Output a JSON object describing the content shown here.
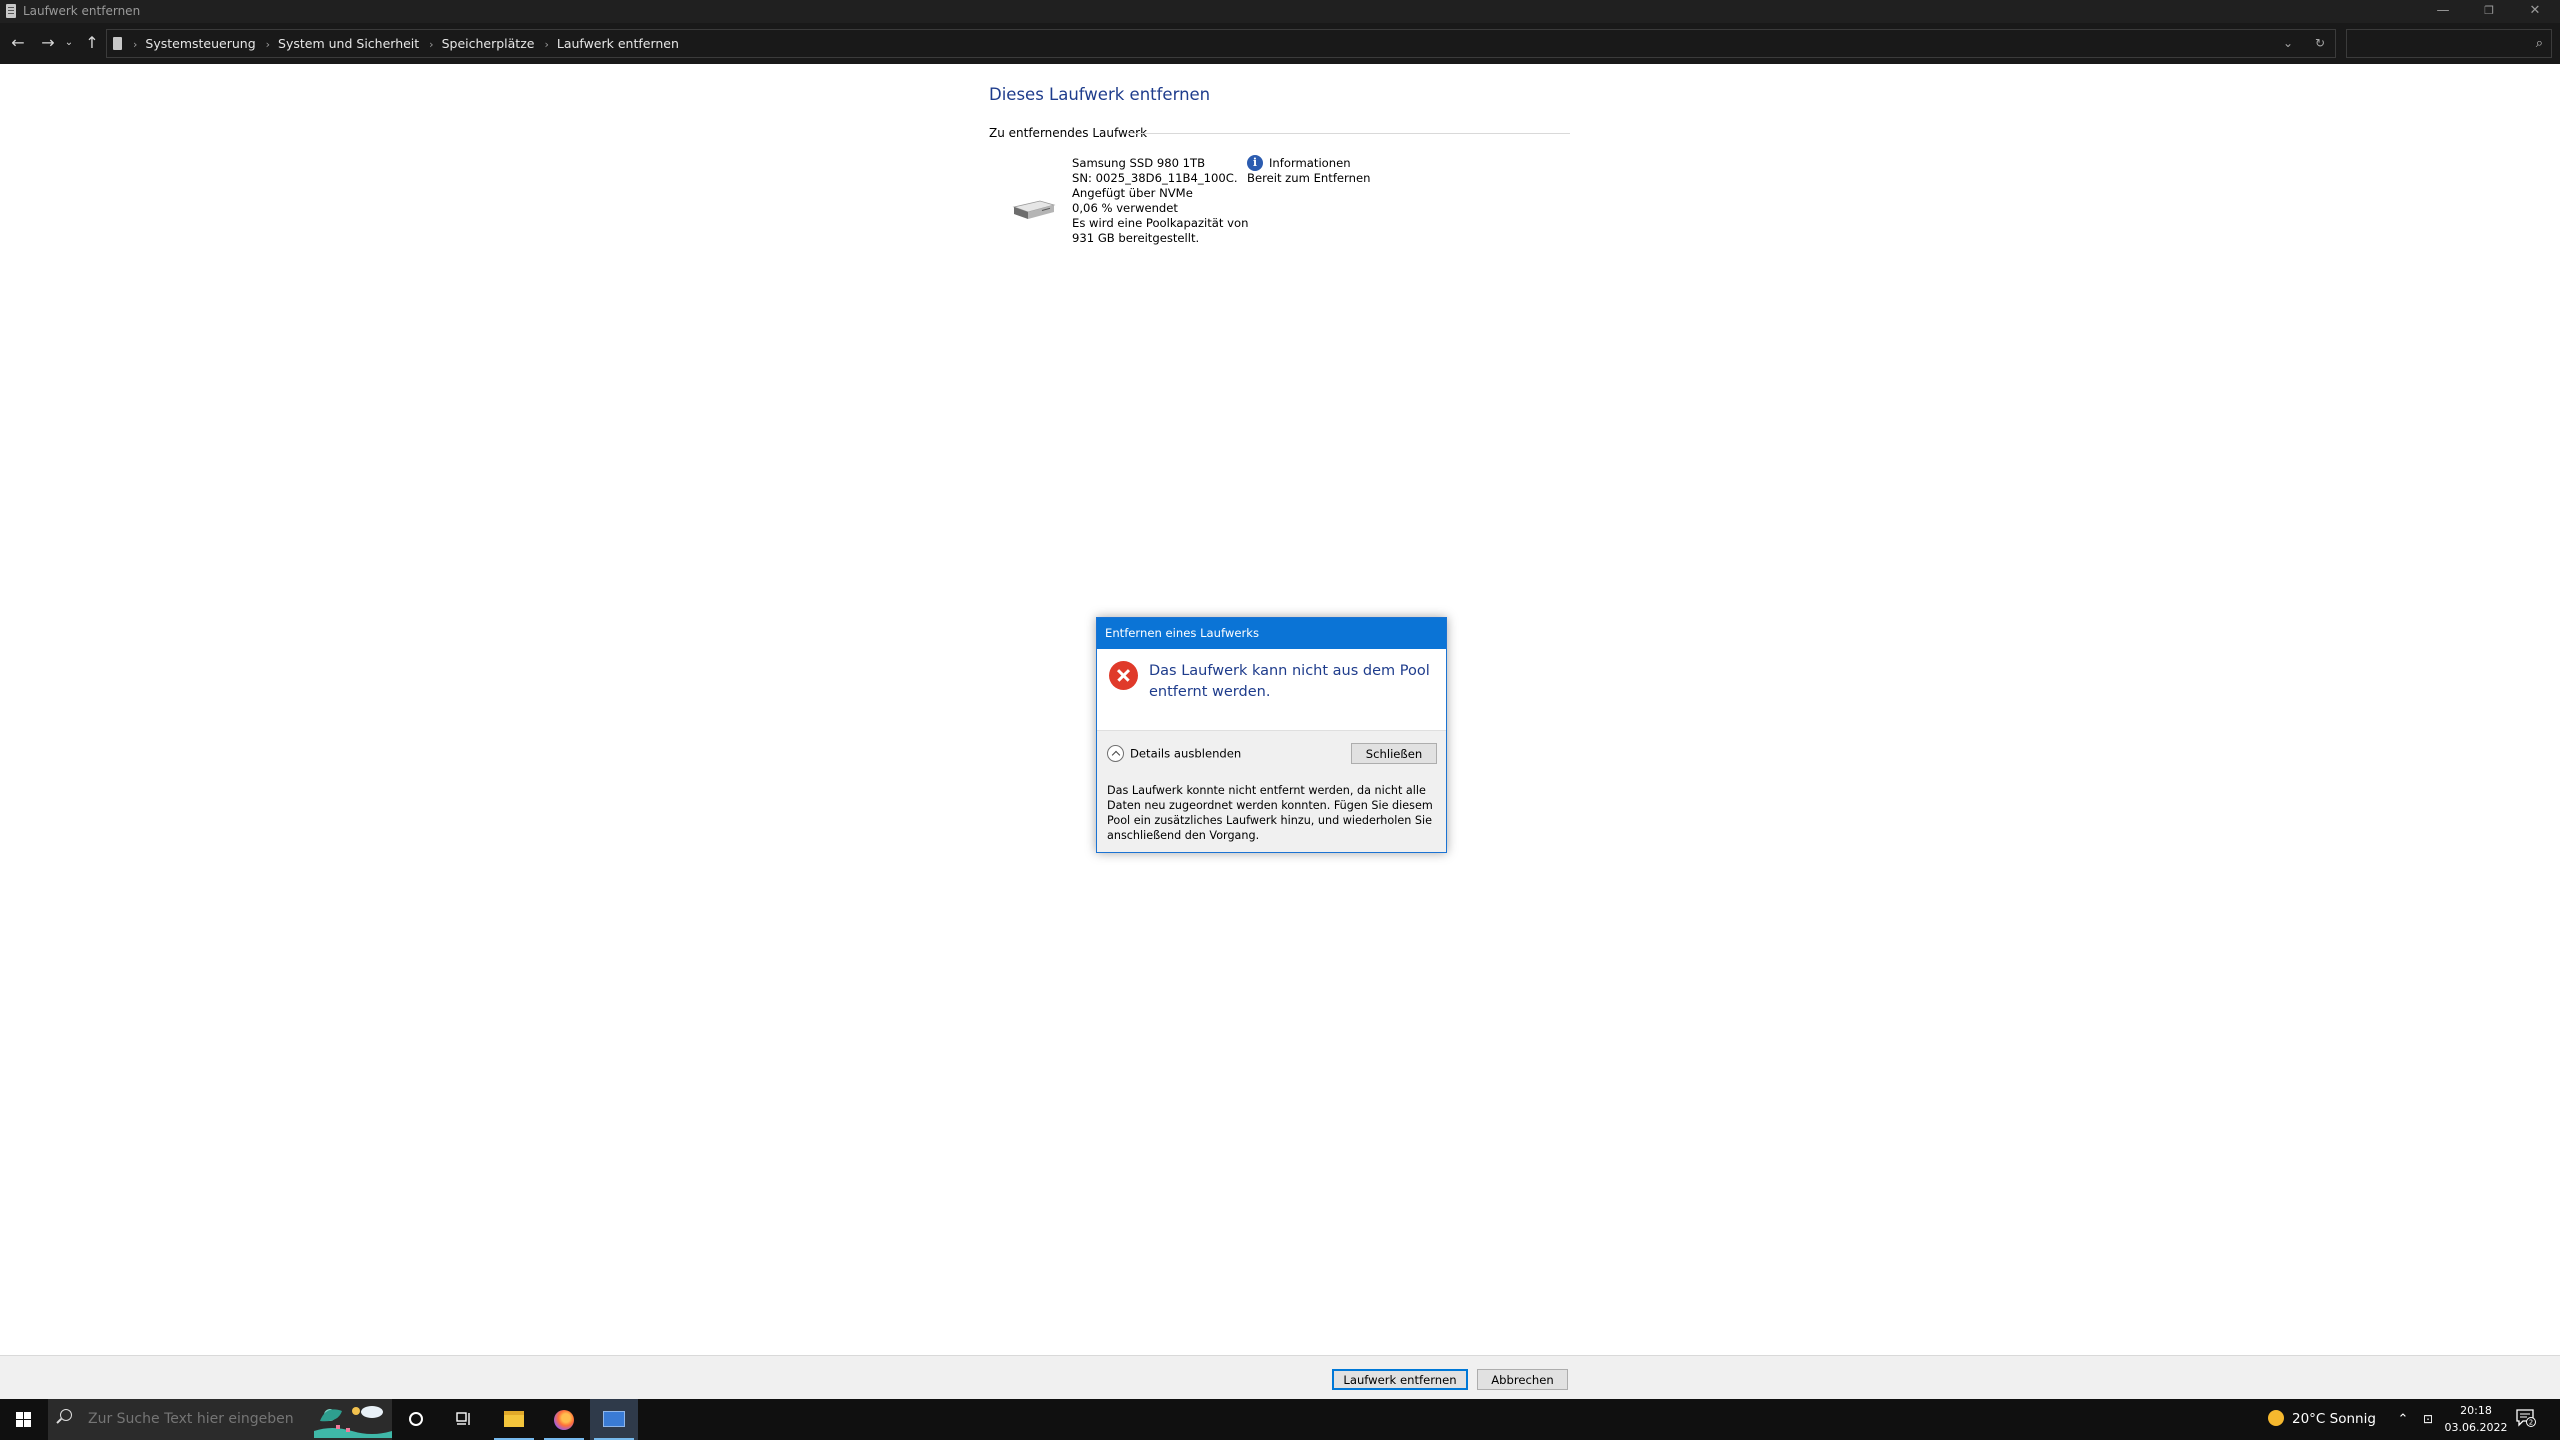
{
  "window": {
    "title": "Laufwerk entfernen",
    "controls": {
      "minimize": "—",
      "maximize": "❐",
      "close": "✕"
    }
  },
  "address": {
    "breadcrumbs": [
      "Systemsteuerung",
      "System und Sicherheit",
      "Speicherplätze",
      "Laufwerk entfernen"
    ],
    "search_placeholder": ""
  },
  "main": {
    "title": "Dieses Laufwerk entfernen",
    "section": "Zu entfernendes Laufwerk",
    "drive": {
      "icon": "drive-icon",
      "name": "Samsung SSD 980 1TB",
      "serial": "SN: 0025_38D6_11B4_100C.",
      "connection": "Angefügt über NVMe",
      "usage": "0,06 % verwendet",
      "capacity_line1": "Es wird eine Poolkapazität von",
      "capacity_line2": "931 GB bereitgestellt."
    },
    "info": {
      "label": "Informationen",
      "status": "Bereit zum Entfernen"
    }
  },
  "dialog": {
    "title": "Entfernen eines Laufwerks",
    "message": "Das Laufwerk kann nicht aus dem Pool entfernt werden.",
    "details_toggle": "Details ausblenden",
    "close_label": "Schließen",
    "details": "Das Laufwerk konnte nicht entfernt werden, da nicht alle Daten neu zugeordnet werden konnten. Fügen Sie diesem Pool ein zusätzliches Laufwerk hinzu, und wiederholen Sie anschließend den Vorgang."
  },
  "buttons": {
    "remove": "Laufwerk entfernen",
    "cancel": "Abbrechen"
  },
  "taskbar": {
    "search_placeholder": "Zur Suche Text hier eingeben",
    "weather": "20°C  Sonnig",
    "time": "20:18",
    "date": "03.06.2022",
    "notification_count": "2"
  },
  "colors": {
    "accent": "#0b74d6",
    "link_title": "#1e3c8c",
    "error": "#e03a2a"
  }
}
